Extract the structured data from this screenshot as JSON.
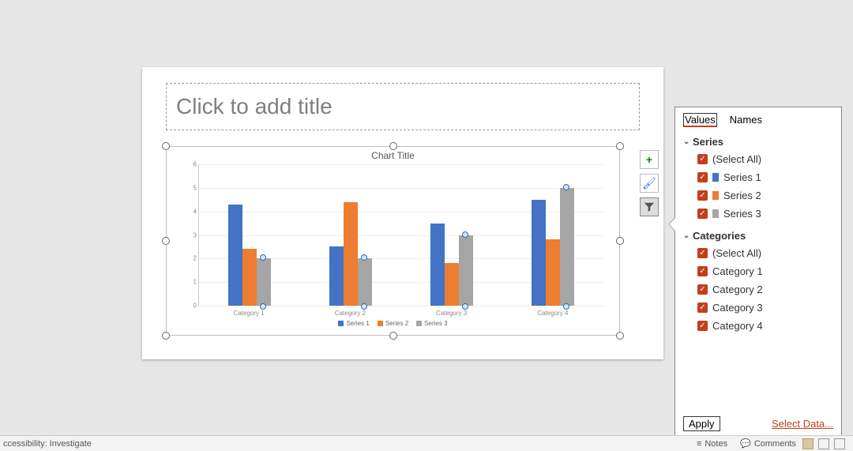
{
  "slide": {
    "title_placeholder": "Click to add title"
  },
  "chart_data": {
    "type": "bar",
    "title": "Chart Title",
    "categories": [
      "Category 1",
      "Category 2",
      "Category 3",
      "Category 4"
    ],
    "series": [
      {
        "name": "Series 1",
        "values": [
          4.3,
          2.5,
          3.5,
          4.5
        ],
        "color": "#4472c4"
      },
      {
        "name": "Series 2",
        "values": [
          2.4,
          4.4,
          1.8,
          2.8
        ],
        "color": "#ed7d31"
      },
      {
        "name": "Series 3",
        "values": [
          2.0,
          2.0,
          3.0,
          5.0
        ],
        "color": "#a5a5a5"
      }
    ],
    "ylim": [
      0,
      6
    ],
    "yticks": [
      0,
      1,
      2,
      3,
      4,
      5,
      6
    ],
    "xlabel": "",
    "ylabel": ""
  },
  "side_buttons": {
    "add": "+",
    "brush": "✎",
    "filter": "▾"
  },
  "filter": {
    "tabs": {
      "values": "Values",
      "names": "Names"
    },
    "sections": {
      "series": {
        "label": "Series",
        "select_all": "(Select All)",
        "items": [
          "Series 1",
          "Series 2",
          "Series 3"
        ]
      },
      "categories": {
        "label": "Categories",
        "select_all": "(Select All)",
        "items": [
          "Category 1",
          "Category 2",
          "Category 3",
          "Category 4"
        ]
      }
    },
    "apply": "Apply",
    "select_data": "Select Data..."
  },
  "statusbar": {
    "accessibility": "ccessibility: Investigate",
    "notes": "Notes",
    "comments": "Comments"
  }
}
